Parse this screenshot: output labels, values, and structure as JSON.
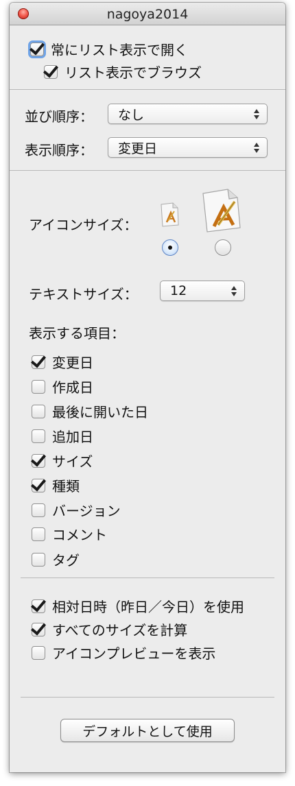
{
  "window": {
    "title": "nagoya2014"
  },
  "top_options": [
    {
      "label": "常にリスト表示で開く",
      "checked": true,
      "focused": true
    },
    {
      "label": "リスト表示でブラウズ",
      "checked": true,
      "focused": false
    }
  ],
  "sort": {
    "arrange_label": "並び順序：",
    "arrange_value": "なし",
    "sort_label": "表示順序：",
    "sort_value": "変更日"
  },
  "icon_size": {
    "label": "アイコンサイズ：",
    "options": [
      {
        "size": "small",
        "selected": true
      },
      {
        "size": "large",
        "selected": false
      }
    ]
  },
  "text_size": {
    "label": "テキストサイズ：",
    "value": "12"
  },
  "columns": {
    "label": "表示する項目：",
    "items": [
      {
        "label": "変更日",
        "checked": true
      },
      {
        "label": "作成日",
        "checked": false
      },
      {
        "label": "最後に開いた日",
        "checked": false
      },
      {
        "label": "追加日",
        "checked": false
      },
      {
        "label": "サイズ",
        "checked": true
      },
      {
        "label": "種類",
        "checked": true
      },
      {
        "label": "バージョン",
        "checked": false
      },
      {
        "label": "コメント",
        "checked": false
      },
      {
        "label": "タグ",
        "checked": false
      }
    ]
  },
  "bottom_options": [
    {
      "label": "相対日時（昨日／今日）を使用",
      "checked": true
    },
    {
      "label": "すべてのサイズを計算",
      "checked": true
    },
    {
      "label": "アイコンプレビューを表示",
      "checked": false
    }
  ],
  "default_button": {
    "label": "デフォルトとして使用"
  },
  "colors": {
    "window_bg": "#ececec",
    "focus_ring": "#6fa3e6",
    "close_button": "#f2594c"
  }
}
